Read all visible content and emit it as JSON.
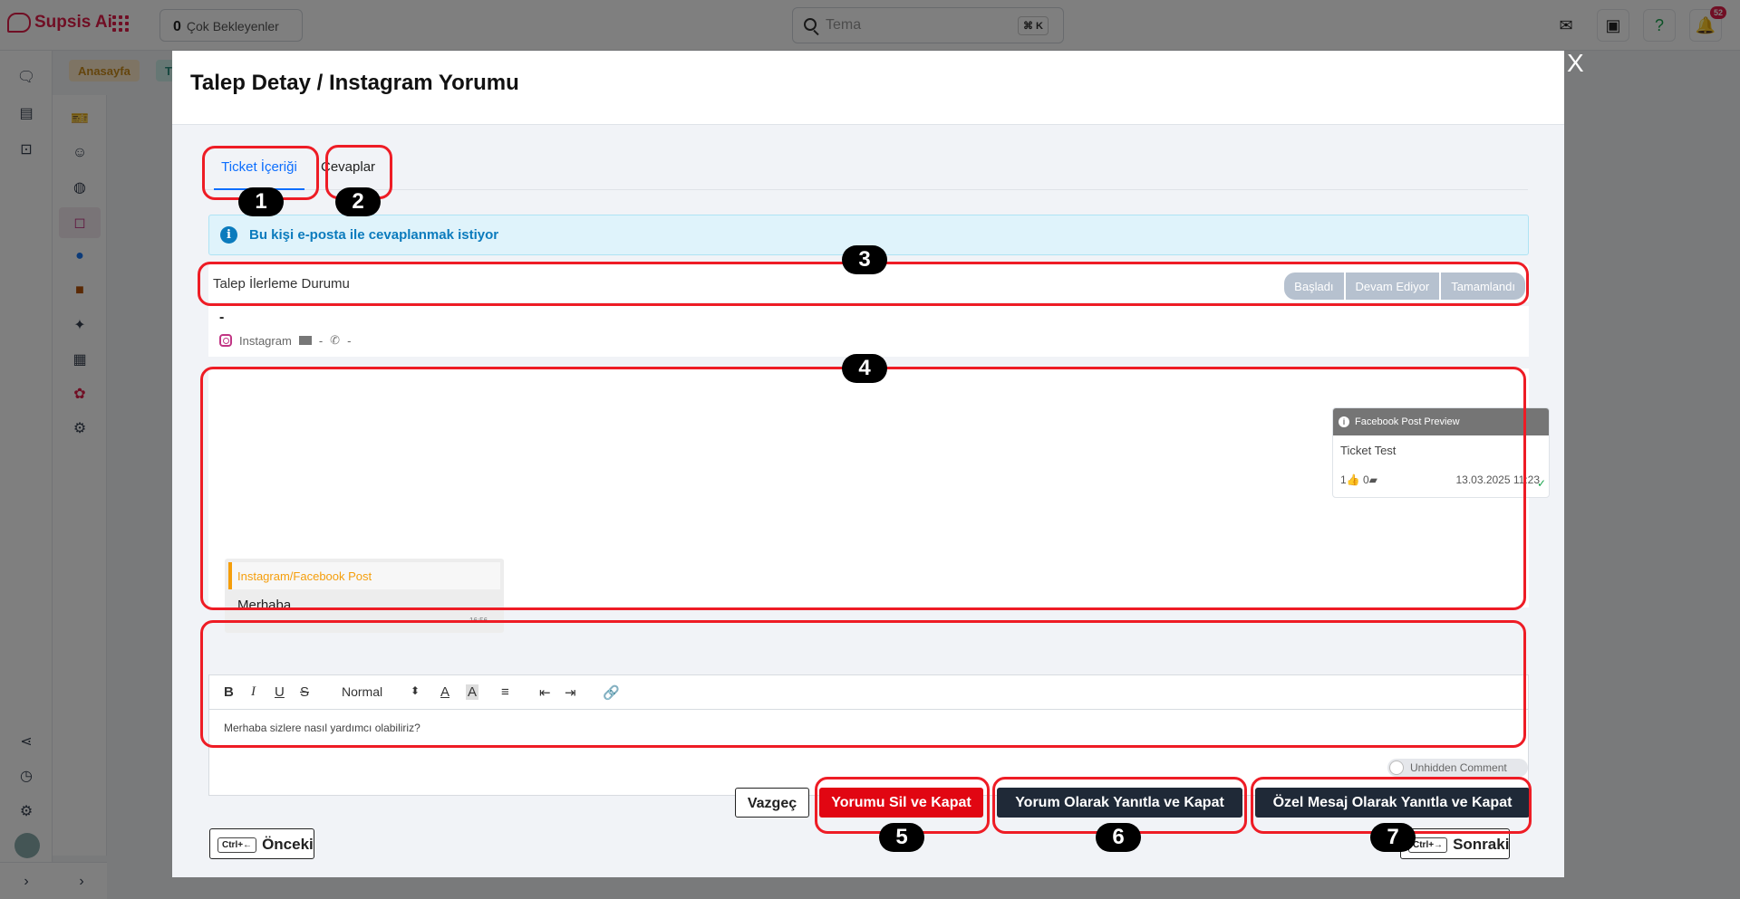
{
  "app": {
    "logo_text": "Supsis Ai",
    "waiting_count": "0",
    "waiting_label": "Çok Bekleyenler",
    "search_placeholder": "Tema",
    "search_shortcut": "⌘ K",
    "notification_count": "52",
    "chips": [
      "Anasayfa",
      "Ti"
    ]
  },
  "modal": {
    "title": "Talep Detay / Instagram Yorumu",
    "close": "X",
    "tabs": [
      {
        "label": "Ticket İçeriği",
        "active": true
      },
      {
        "label": "Cevaplar",
        "active": false
      }
    ],
    "info_text": "Bu kişi e-posta ile cevaplanmak istiyor",
    "progress": {
      "label": "Talep İlerleme Durumu",
      "steps": [
        "Başladı",
        "Devam Ediyor",
        "Tamamlandı"
      ]
    },
    "customer": {
      "name": "-",
      "channel": "Instagram",
      "email": "-",
      "phone": "-"
    },
    "post_preview": {
      "header": "Facebook Post Preview",
      "title": "Ticket Test",
      "likes": "1",
      "comments": "0",
      "date": "13.03.2025 11:23"
    },
    "message": {
      "source": "Instagram/Facebook Post",
      "text": "Merhaba",
      "time": "16:56"
    },
    "editor": {
      "format": "Normal",
      "content": "Merhaba sizlere nasıl yardımcı olabiliriz?"
    },
    "toggle_label": "Unhidden Comment",
    "buttons": {
      "cancel": "Vazgeç",
      "delete_close": "Yorumu Sil ve Kapat",
      "reply_comment": "Yorum Olarak Yanıtla ve Kapat",
      "reply_private": "Özel Mesaj Olarak Yanıtla ve Kapat",
      "prev_key": "Ctrl+←",
      "prev": "Önceki",
      "next_key": "Ctrl+→",
      "next": "Sonraki"
    }
  },
  "annotations": [
    "1",
    "2",
    "3",
    "4",
    "5",
    "6",
    "7"
  ],
  "colors": {
    "highlight": "#ee1c25",
    "primary": "#0d6efd",
    "danger": "#e10612",
    "dark": "#1f2937"
  }
}
